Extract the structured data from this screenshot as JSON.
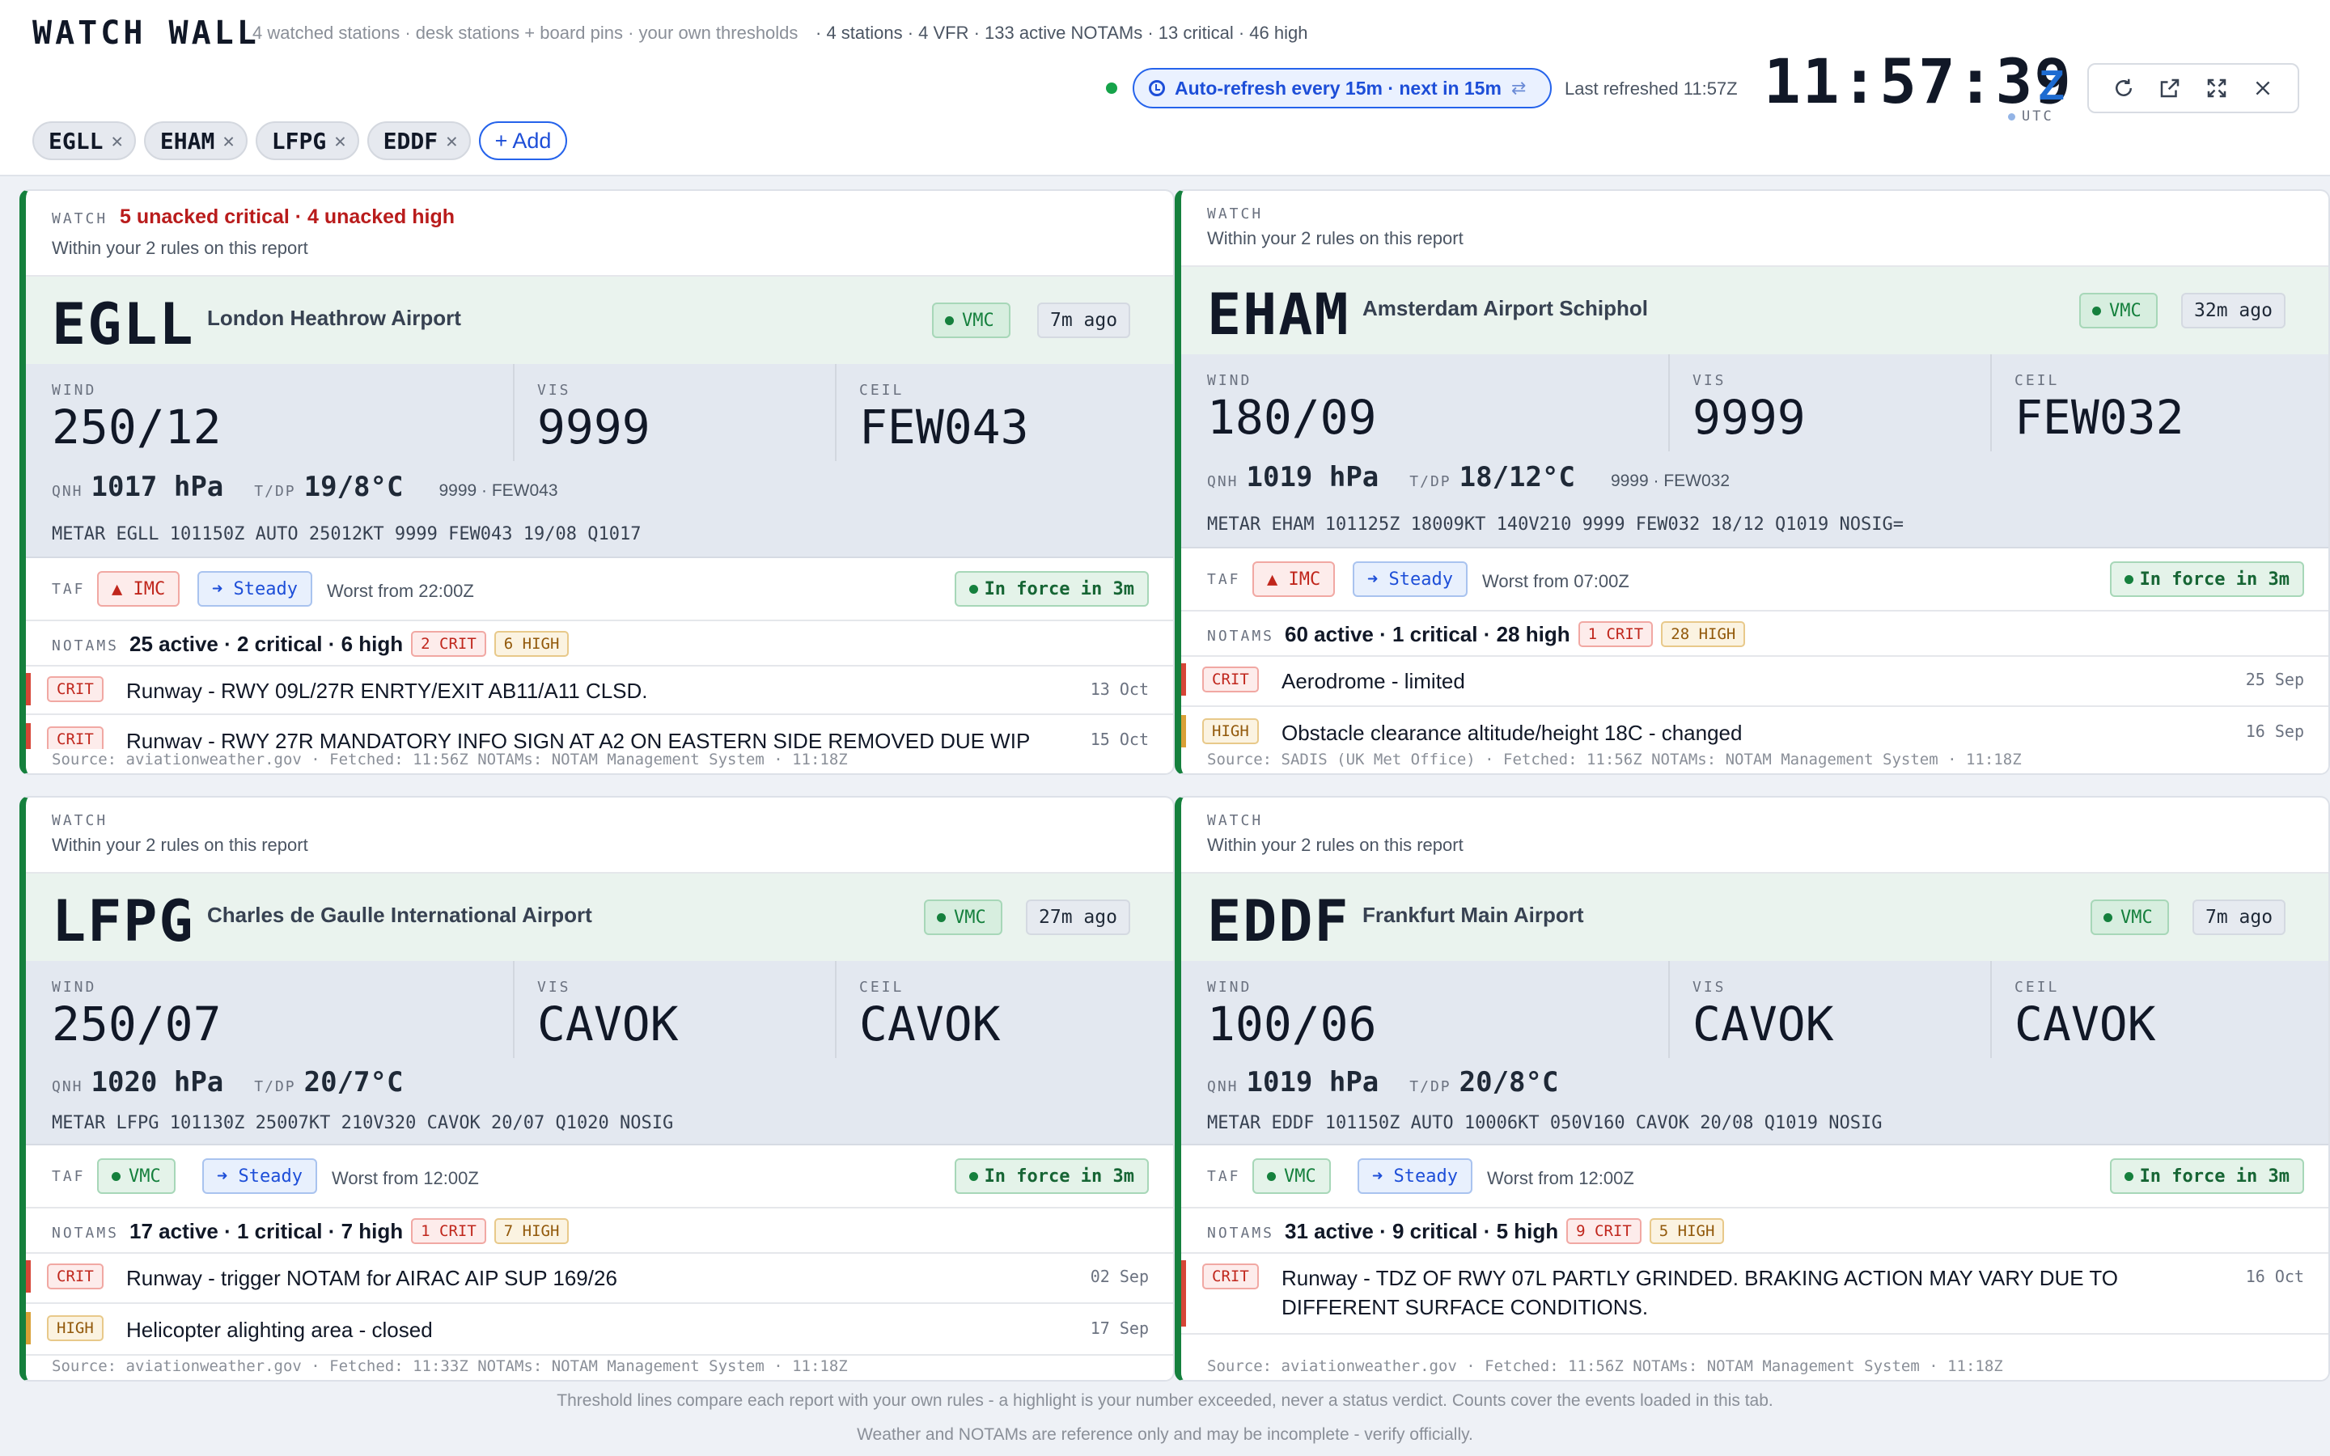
{
  "header": {
    "title": "WATCH WALL",
    "subtitle": "4 watched stations · desk stations + board pins · your own thresholds",
    "summary": "· 4 stations · 4 VFR · 133 active NOTAMs · 13 critical · 46 high",
    "refresh_label": "Auto-refresh every 15m · next in 15m",
    "last_refreshed": "Last refreshed 11:57Z",
    "clock": "11:57:39",
    "clock_suffix": "Z",
    "clock_zone": "UTC",
    "add_label": "+ Add",
    "chips": [
      "EGLL",
      "EHAM",
      "LFPG",
      "EDDF"
    ]
  },
  "labels": {
    "watch": "WATCH",
    "wind": "WIND",
    "vis": "VIS",
    "ceil": "CEIL",
    "qnh": "QNH",
    "tdp": "T/DP",
    "taf": "TAF",
    "notams": "NOTAMS",
    "steady": "➜ Steady",
    "in_force": "In force in 3m"
  },
  "cards": [
    {
      "alert": "5 unacked critical · 4 unacked high",
      "rules": "Within your 2 rules on this report",
      "icao": "EGLL",
      "name": "London Heathrow Airport",
      "flight_cat": "VMC",
      "age": "7m ago",
      "wind": "250/12",
      "vis": "9999",
      "ceil": "FEW043",
      "qnh": "1017 hPa",
      "tdp": "19/8°C",
      "extra": "9999 · FEW043",
      "metar": "METAR EGLL 101150Z AUTO 25012KT 9999 FEW043 19/08 Q1017",
      "taf_cat": "▲ IMC",
      "taf_worst": "Worst from 22:00Z",
      "notam_summary": "25 active · 2 critical · 6 high",
      "crit_tag": "2 CRIT",
      "high_tag": "6 HIGH",
      "notams": [
        {
          "sev": "CRIT",
          "text": "Runway - RWY 09L/27R ENRTY/EXIT AB11/A11 CLSD.",
          "date": "13 Oct"
        },
        {
          "sev": "CRIT",
          "text": "Runway - RWY 27R MANDATORY INFO SIGN AT A2 ON EASTERN SIDE REMOVED DUE WIP",
          "date": "15 Oct"
        }
      ],
      "source": "Source: aviationweather.gov · Fetched: 11:56Z   NOTAMs: NOTAM Management System · 11:18Z"
    },
    {
      "alert": "",
      "rules": "Within your 2 rules on this report",
      "icao": "EHAM",
      "name": "Amsterdam Airport Schiphol",
      "flight_cat": "VMC",
      "age": "32m ago",
      "wind": "180/09",
      "vis": "9999",
      "ceil": "FEW032",
      "qnh": "1019 hPa",
      "tdp": "18/12°C",
      "extra": "9999 · FEW032",
      "metar": "METAR EHAM 101125Z 18009KT 140V210 9999 FEW032 18/12 Q1019 NOSIG=",
      "taf_cat": "▲ IMC",
      "taf_worst": "Worst from 07:00Z",
      "notam_summary": "60 active · 1 critical · 28 high",
      "crit_tag": "1 CRIT",
      "high_tag": "28 HIGH",
      "notams": [
        {
          "sev": "CRIT",
          "text": "Aerodrome - limited",
          "date": "25 Sep"
        },
        {
          "sev": "HIGH",
          "text": "Obstacle clearance altitude/height 18C - changed",
          "date": "16 Sep"
        }
      ],
      "source": "Source: SADIS (UK Met Office) · Fetched: 11:56Z   NOTAMs: NOTAM Management System · 11:18Z"
    },
    {
      "alert": "",
      "rules": "Within your 2 rules on this report",
      "icao": "LFPG",
      "name": "Charles de Gaulle International Airport",
      "flight_cat": "VMC",
      "age": "27m ago",
      "wind": "250/07",
      "vis": "CAVOK",
      "ceil": "CAVOK",
      "qnh": "1020 hPa",
      "tdp": "20/7°C",
      "extra": "",
      "metar": "METAR LFPG 101130Z 25007KT 210V320 CAVOK 20/07 Q1020 NOSIG",
      "taf_cat": "VMC",
      "taf_worst": "Worst from 12:00Z",
      "notam_summary": "17 active · 1 critical · 7 high",
      "crit_tag": "1 CRIT",
      "high_tag": "7 HIGH",
      "notams": [
        {
          "sev": "CRIT",
          "text": "Runway - trigger NOTAM for AIRAC AIP SUP 169/26",
          "date": "02 Sep"
        },
        {
          "sev": "HIGH",
          "text": "Helicopter alighting area - closed",
          "date": "17 Sep"
        }
      ],
      "source": "Source: aviationweather.gov · Fetched: 11:33Z   NOTAMs: NOTAM Management System · 11:18Z"
    },
    {
      "alert": "",
      "rules": "Within your 2 rules on this report",
      "icao": "EDDF",
      "name": "Frankfurt Main Airport",
      "flight_cat": "VMC",
      "age": "7m ago",
      "wind": "100/06",
      "vis": "CAVOK",
      "ceil": "CAVOK",
      "qnh": "1019 hPa",
      "tdp": "20/8°C",
      "extra": "",
      "metar": "METAR EDDF 101150Z AUTO 10006KT 050V160 CAVOK 20/08 Q1019 NOSIG",
      "taf_cat": "VMC",
      "taf_worst": "Worst from 12:00Z",
      "notam_summary": "31 active · 9 critical · 5 high",
      "crit_tag": "9 CRIT",
      "high_tag": "5 HIGH",
      "notams": [
        {
          "sev": "CRIT",
          "text": "Runway - TDZ OF RWY 07L PARTLY GRINDED. BRAKING ACTION MAY VARY DUE TO DIFFERENT SURFACE CONDITIONS.",
          "date": "16 Oct"
        }
      ],
      "source": "Source: aviationweather.gov · Fetched: 11:56Z   NOTAMs: NOTAM Management System · 11:18Z"
    }
  ],
  "footer": {
    "line1": "Threshold lines compare each report with your own rules - a highlight is your number exceeded, never a status verdict. Counts cover the events loaded in this tab.",
    "line2": "Weather and NOTAMs are reference only and may be incomplete - verify officially."
  },
  "colors": {
    "accent": "#1d4ed8",
    "vmc_green": "#15803d",
    "critical_red": "#c0261c",
    "high_amber": "#92590b"
  },
  "icons": [
    "clock-icon",
    "swap-icon",
    "refresh-icon",
    "external-link-icon",
    "fullscreen-icon",
    "close-icon"
  ]
}
